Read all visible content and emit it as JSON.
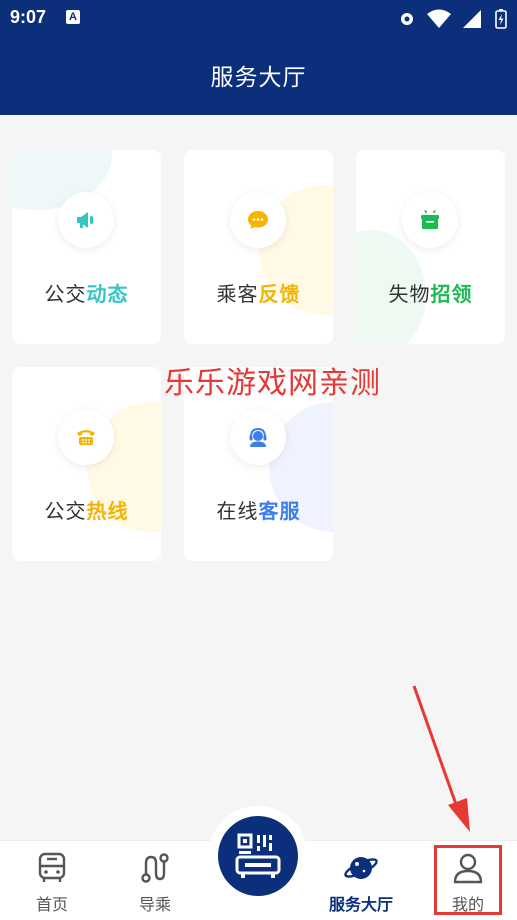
{
  "status_bar": {
    "time": "9:07",
    "indicator": "A"
  },
  "header": {
    "title": "服务大厅"
  },
  "cards": [
    {
      "label_plain": "公交",
      "label_accent": "动态",
      "accent_color": "#36c5c5",
      "icon": "megaphone-icon"
    },
    {
      "label_plain": "乘客",
      "label_accent": "反馈",
      "accent_color": "#f5b400",
      "icon": "chat-bubble-icon"
    },
    {
      "label_plain": "失物",
      "label_accent": "招领",
      "accent_color": "#1db954",
      "icon": "gift-box-icon"
    },
    {
      "label_plain": "公交",
      "label_accent": "热线",
      "accent_color": "#f5b400",
      "icon": "telephone-icon"
    },
    {
      "label_plain": "在线",
      "label_accent": "客服",
      "accent_color": "#3d7eea",
      "icon": "customer-service-icon"
    }
  ],
  "watermark": "乐乐游戏网亲测",
  "tabbar": {
    "tabs": [
      {
        "label": "首页",
        "icon": "bus-icon"
      },
      {
        "label": "导乘",
        "icon": "route-icon"
      },
      {
        "label": "服务大厅",
        "icon": "planet-icon",
        "active": true
      },
      {
        "label": "我的",
        "icon": "user-icon"
      }
    ],
    "center_icon": "qr-scan-icon"
  },
  "colors": {
    "primary": "#0b2f7a",
    "annotation": "#e53935"
  }
}
